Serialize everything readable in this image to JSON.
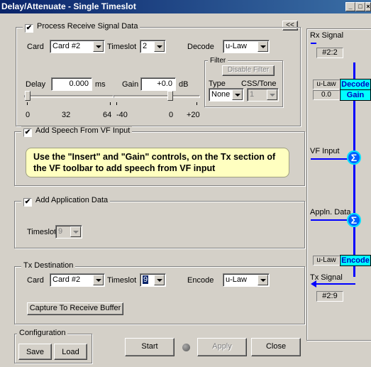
{
  "window": {
    "title": "Delay/Attenuate - Single Timeslot"
  },
  "collapse_label": "<<",
  "receive": {
    "group_label": "Process Receive Signal Data",
    "checked": true,
    "card_label": "Card",
    "card_value": "Card #2",
    "timeslot_label": "Timeslot",
    "timeslot_value": "2",
    "decode_label": "Decode",
    "decode_value": "u-Law",
    "filter_label": "Filter",
    "disable_filter_label": "Disable Filter",
    "type_label": "Type",
    "type_value": "None",
    "css_label": "CSS/Tone",
    "css_value": "1",
    "delay_label": "Delay",
    "delay_value": "0.000",
    "delay_unit": "ms",
    "delay_ticks": [
      "0",
      "32",
      "64"
    ],
    "delay_level_percent": 0,
    "gain_label": "Gain",
    "gain_value": "+0.0",
    "gain_unit": "dB",
    "gain_ticks": [
      "-40",
      "0",
      "+20"
    ],
    "gain_level_db": 0
  },
  "speech": {
    "group_label": "Add Speech From VF Input",
    "checked": true,
    "message": "Use the \"Insert\" and \"Gain\" controls, on the Tx section of the VF toolbar to add speech from VF input"
  },
  "application": {
    "group_label": "Add Application Data",
    "checked": true,
    "timeslot_label": "Timeslot",
    "timeslot_value": "9"
  },
  "tx": {
    "group_label": "Tx Destination",
    "card_label": "Card",
    "card_value": "Card #2",
    "timeslot_label": "Timeslot",
    "timeslot_value": "9",
    "encode_label": "Encode",
    "encode_value": "u-Law",
    "capture_label": "Capture To Receive Buffer"
  },
  "config": {
    "group_label": "Configuration",
    "save_label": "Save",
    "load_label": "Load"
  },
  "buttons": {
    "start_label": "Start",
    "apply_label": "Apply",
    "close_label": "Close"
  },
  "diagram": {
    "rx_signal_label": "Rx Signal",
    "rx_signal_value": "#2:2",
    "decode_law": "u-Law",
    "decode_box": "Decode",
    "gain_value": "0.0",
    "gain_box": "Gain",
    "vf_input_label": "VF Input",
    "appln_label": "Appln. Data",
    "encode_law": "u-Law",
    "encode_box": "Encode",
    "tx_signal_label": "Tx Signal",
    "tx_signal_value": "#2:9",
    "sum_symbol": "Σ"
  },
  "colors": {
    "titlebar": "#0a246a",
    "flow_line": "#0000ff",
    "box_fill": "#00ffff",
    "message_bg": "#ffffc0"
  }
}
